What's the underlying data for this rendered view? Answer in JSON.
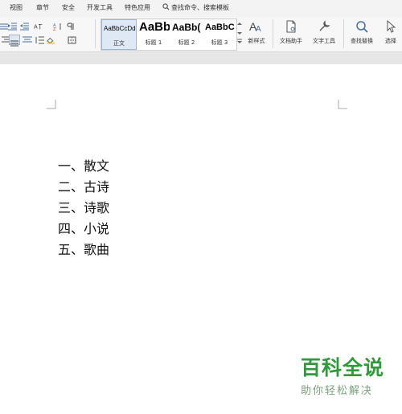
{
  "menu_tabs": [
    "视图",
    "章节",
    "安全",
    "开发工具",
    "特色应用"
  ],
  "search": {
    "label": "查找命令、搜索模板"
  },
  "styles": [
    {
      "sample": "AaBbCcDd",
      "name": "正文",
      "selected": true
    },
    {
      "sample": "AaBb",
      "name": "标题 1"
    },
    {
      "sample": "AaBb(",
      "name": "标题 2"
    },
    {
      "sample": "AaBbC",
      "name": "标题 3"
    }
  ],
  "ribbon_buttons": {
    "new_style": "新样式",
    "doc_assistant": "文档助手",
    "text_tools": "文字工具",
    "find_replace": "查找替换",
    "select": "选择"
  },
  "document": {
    "list": [
      "一、散文",
      "二、古诗",
      "三、诗歌",
      "四、小说",
      "五、歌曲"
    ]
  },
  "watermark": {
    "title": "百科全说",
    "subtitle": "助你轻松解决"
  }
}
